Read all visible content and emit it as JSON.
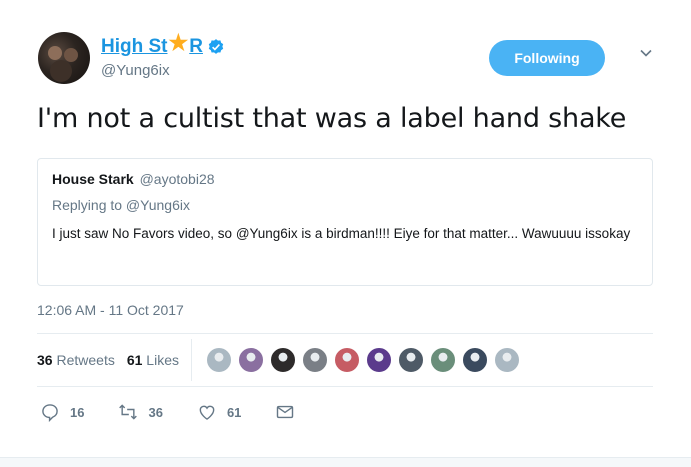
{
  "author": {
    "name_part1": "High St",
    "name_part2": "R",
    "handle": "@Yung6ix",
    "verified": true
  },
  "follow_button": {
    "label": "Following"
  },
  "tweet": {
    "text": "I'm not a cultist that was a label hand shake"
  },
  "quoted_tweet": {
    "name": "House Stark",
    "handle": "@ayotobi28",
    "replying_to": "Replying to @Yung6ix",
    "text": "I just saw No Favors video, so @Yung6ix is a birdman!!!! Eiye for that matter... Wawuuuu issokay"
  },
  "timestamp": "12:06 AM - 11 Oct 2017",
  "stats": {
    "retweets_count": "36",
    "retweets_label": "Retweets",
    "likes_count": "61",
    "likes_label": "Likes"
  },
  "liker_avatars": [
    {
      "color": "#aab8c2"
    },
    {
      "color": "#8a6fa0"
    },
    {
      "color": "#2d2a2a"
    },
    {
      "color": "#7a7f86"
    },
    {
      "color": "#c65c64"
    },
    {
      "color": "#5b3b8c"
    },
    {
      "color": "#4e5a66"
    },
    {
      "color": "#6a8e7a"
    },
    {
      "color": "#3a4a5e"
    },
    {
      "color": "#aab8c2"
    }
  ],
  "actions": {
    "reply_count": "16",
    "retweet_count": "36",
    "like_count": "61"
  },
  "colors": {
    "accent": "#1b95e0",
    "follow_bg": "#4ab3f4",
    "muted": "#657786",
    "star": "#ffad1f"
  }
}
